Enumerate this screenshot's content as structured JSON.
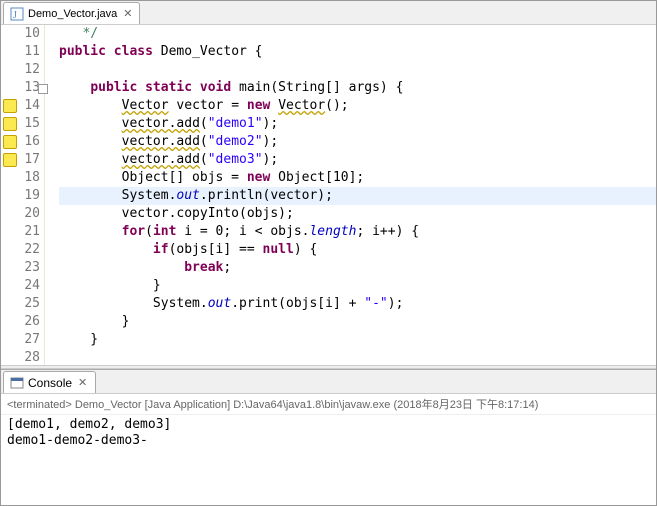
{
  "editor": {
    "tab": {
      "label": "Demo_Vector.java",
      "closeGlyph": "✕"
    },
    "lines": [
      {
        "num": "10",
        "warn": false,
        "fold": false,
        "hl": false,
        "tokens": [
          [
            "",
            "   "
          ],
          [
            "cmt",
            "*/"
          ]
        ]
      },
      {
        "num": "11",
        "warn": false,
        "fold": false,
        "hl": false,
        "tokens": [
          [
            "kw",
            "public"
          ],
          [
            "",
            " "
          ],
          [
            "kw",
            "class"
          ],
          [
            "",
            " Demo_Vector {"
          ]
        ]
      },
      {
        "num": "12",
        "warn": false,
        "fold": false,
        "hl": false,
        "tokens": [
          [
            "",
            ""
          ]
        ]
      },
      {
        "num": "13",
        "warn": false,
        "fold": true,
        "hl": false,
        "tokens": [
          [
            "",
            "    "
          ],
          [
            "kw",
            "public"
          ],
          [
            "",
            " "
          ],
          [
            "kw",
            "static"
          ],
          [
            "",
            " "
          ],
          [
            "kw",
            "void"
          ],
          [
            "",
            " main(String[] args) {"
          ]
        ]
      },
      {
        "num": "14",
        "warn": true,
        "fold": false,
        "hl": false,
        "tokens": [
          [
            "",
            "        "
          ],
          [
            "ann",
            "Vector"
          ],
          [
            "",
            " vector = "
          ],
          [
            "kw",
            "new"
          ],
          [
            "",
            " "
          ],
          [
            "ann",
            "Vector"
          ],
          [
            "",
            "();"
          ]
        ]
      },
      {
        "num": "15",
        "warn": true,
        "fold": false,
        "hl": false,
        "tokens": [
          [
            "",
            "        "
          ],
          [
            "ann",
            "vector.add"
          ],
          [
            "",
            "("
          ],
          [
            "str",
            "\"demo1\""
          ],
          [
            "",
            ");"
          ]
        ]
      },
      {
        "num": "16",
        "warn": true,
        "fold": false,
        "hl": false,
        "tokens": [
          [
            "",
            "        "
          ],
          [
            "ann",
            "vector.add"
          ],
          [
            "",
            "("
          ],
          [
            "str",
            "\"demo2\""
          ],
          [
            "",
            ");"
          ]
        ]
      },
      {
        "num": "17",
        "warn": true,
        "fold": false,
        "hl": false,
        "tokens": [
          [
            "",
            "        "
          ],
          [
            "ann",
            "vector.add"
          ],
          [
            "",
            "("
          ],
          [
            "str",
            "\"demo3\""
          ],
          [
            "",
            ");"
          ]
        ]
      },
      {
        "num": "18",
        "warn": false,
        "fold": false,
        "hl": false,
        "tokens": [
          [
            "",
            "        Object[] objs = "
          ],
          [
            "kw",
            "new"
          ],
          [
            "",
            " Object[10];"
          ]
        ]
      },
      {
        "num": "19",
        "warn": false,
        "fold": false,
        "hl": true,
        "tokens": [
          [
            "",
            "        System."
          ],
          [
            "fld",
            "out"
          ],
          [
            "",
            ".println(vector);"
          ]
        ]
      },
      {
        "num": "20",
        "warn": false,
        "fold": false,
        "hl": false,
        "tokens": [
          [
            "",
            "        vector.copyInto(objs);"
          ]
        ]
      },
      {
        "num": "21",
        "warn": false,
        "fold": false,
        "hl": false,
        "tokens": [
          [
            "",
            "        "
          ],
          [
            "kw",
            "for"
          ],
          [
            "",
            "("
          ],
          [
            "kw",
            "int"
          ],
          [
            "",
            " i = 0; i < objs."
          ],
          [
            "fld",
            "length"
          ],
          [
            "",
            "; i++) {"
          ]
        ]
      },
      {
        "num": "22",
        "warn": false,
        "fold": false,
        "hl": false,
        "tokens": [
          [
            "",
            "            "
          ],
          [
            "kw",
            "if"
          ],
          [
            "",
            "(objs[i] == "
          ],
          [
            "kw",
            "null"
          ],
          [
            "",
            ") {"
          ]
        ]
      },
      {
        "num": "23",
        "warn": false,
        "fold": false,
        "hl": false,
        "tokens": [
          [
            "",
            "                "
          ],
          [
            "kw",
            "break"
          ],
          [
            "",
            ";"
          ]
        ]
      },
      {
        "num": "24",
        "warn": false,
        "fold": false,
        "hl": false,
        "tokens": [
          [
            "",
            "            }"
          ]
        ]
      },
      {
        "num": "25",
        "warn": false,
        "fold": false,
        "hl": false,
        "tokens": [
          [
            "",
            "            System."
          ],
          [
            "fld",
            "out"
          ],
          [
            "",
            ".print(objs[i] + "
          ],
          [
            "str",
            "\"-\""
          ],
          [
            "",
            ");"
          ]
        ]
      },
      {
        "num": "26",
        "warn": false,
        "fold": false,
        "hl": false,
        "tokens": [
          [
            "",
            "        }"
          ]
        ]
      },
      {
        "num": "27",
        "warn": false,
        "fold": false,
        "hl": false,
        "tokens": [
          [
            "",
            "    }"
          ]
        ]
      },
      {
        "num": "28",
        "warn": false,
        "fold": false,
        "hl": false,
        "tokens": [
          [
            "",
            ""
          ]
        ]
      }
    ]
  },
  "console": {
    "tabLabel": "Console",
    "tabClose": "✕",
    "header": "<terminated> Demo_Vector [Java Application] D:\\Java64\\java1.8\\bin\\javaw.exe (2018年8月23日 下午8:17:14)",
    "output": "[demo1, demo2, demo3]\ndemo1-demo2-demo3-"
  }
}
